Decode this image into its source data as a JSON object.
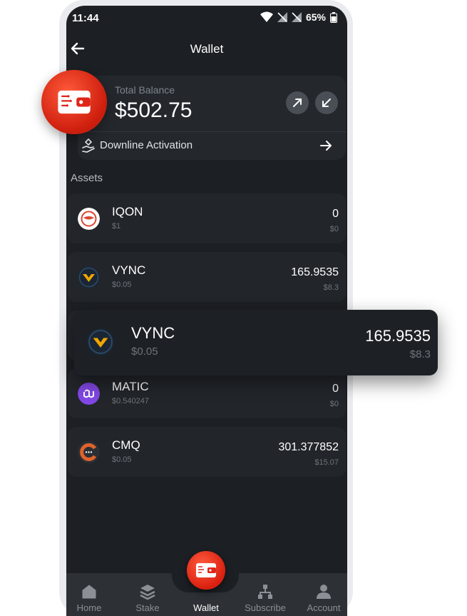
{
  "status": {
    "time": "11:44",
    "battery": "65%"
  },
  "header": {
    "title": "Wallet",
    "back_icon": "arrow-left-icon"
  },
  "balance": {
    "label": "Total Balance",
    "value": "$502.75",
    "send_icon": "arrow-up-right-icon",
    "receive_icon": "arrow-down-left-icon"
  },
  "downline": {
    "label": "Downline Activation",
    "icon": "hand-diamond-icon",
    "arrow_icon": "arrow-right-icon"
  },
  "assets": {
    "heading": "Assets",
    "items": [
      {
        "symbol": "IQON",
        "price": "$1",
        "amount": "0",
        "value": "$0"
      },
      {
        "symbol": "VYNC",
        "price": "$0.05",
        "amount": "165.9535",
        "value": "$8.3"
      },
      {
        "symbol": "MATIC",
        "price": "$0.540247",
        "amount": "0",
        "value": "$0"
      },
      {
        "symbol": "CMQ",
        "price": "$0.05",
        "amount": "301.377852",
        "value": "$15.07"
      }
    ]
  },
  "highlight": {
    "symbol": "VYNC",
    "price": "$0.05",
    "amount": "165.9535",
    "value": "$8.3"
  },
  "nav": {
    "items": [
      {
        "label": "Home",
        "icon": "home-icon"
      },
      {
        "label": "Stake",
        "icon": "layers-icon"
      },
      {
        "label": "Wallet",
        "icon": "wallet-icon"
      },
      {
        "label": "Subscribe",
        "icon": "network-icon"
      },
      {
        "label": "Account",
        "icon": "user-icon"
      }
    ]
  },
  "colors": {
    "accent": "#e0261a",
    "background": "#1c1f23",
    "card": "#22262b",
    "matic": "#8247e5",
    "cmq": "#e0632a",
    "vync": "#f0a500"
  }
}
